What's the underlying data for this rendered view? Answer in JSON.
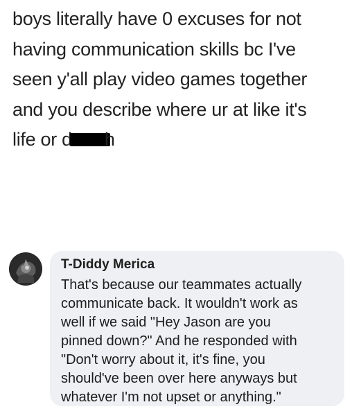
{
  "post": {
    "lines": [
      "boys literally have 0 excuses for not",
      "having communication skills bc I've",
      "seen y'all play video games together",
      "and you describe where ur at like it's"
    ],
    "last_line_start": "life or d",
    "last_line_end": "h"
  },
  "comment": {
    "avatar_icon": "profile-photo-icon",
    "author": "T-Diddy Merica",
    "lines": [
      "That's because our teammates actually",
      "communicate back. It wouldn't work as",
      "well if we said \"Hey Jason are you",
      "pinned down?\" And he responded with",
      "\"Don't worry about it, it's fine, you",
      "should've been over here anyways but",
      "whatever I'm not upset or anything.\""
    ],
    "bubble_color": "#eef0f3"
  }
}
